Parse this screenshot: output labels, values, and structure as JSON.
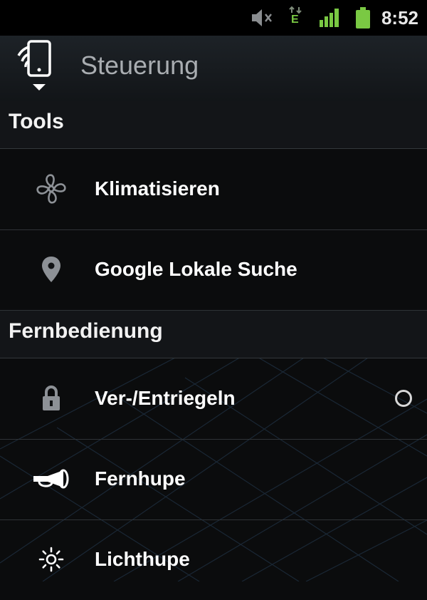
{
  "status_bar": {
    "time": "8:52",
    "network_type": "E",
    "icons": [
      "mute-icon",
      "data-transfer-icon",
      "signal-icon",
      "battery-icon"
    ]
  },
  "action_bar": {
    "title": "Steuerung",
    "icon": "remote-phone-icon"
  },
  "sections": [
    {
      "label": "Tools",
      "items": [
        {
          "label": "Klimatisieren",
          "icon": "fan-icon"
        },
        {
          "label": "Google Lokale Suche",
          "icon": "map-pin-icon"
        }
      ]
    },
    {
      "label": "Fernbedienung",
      "items": [
        {
          "label": "Ver-/Entriegeln",
          "icon": "lock-icon",
          "status": "loading-spinner"
        },
        {
          "label": "Fernhupe",
          "icon": "horn-icon"
        },
        {
          "label": "Lichthupe",
          "icon": "light-flash-icon"
        }
      ]
    }
  ],
  "colors": {
    "background": "#0b0c0d",
    "accent_green": "#7ac943",
    "title_gray": "#a9adb1",
    "icon_gray": "#8d9196"
  }
}
